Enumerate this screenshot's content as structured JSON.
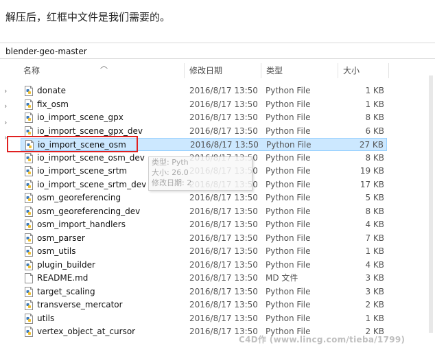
{
  "caption": "解压后，红框中文件是我们需要的。",
  "address": "blender-geo-master",
  "columns": {
    "name": "名称",
    "date": "修改日期",
    "type": "类型",
    "size": "大小"
  },
  "files": [
    {
      "name": "donate",
      "date": "2016/8/17 13:50",
      "type": "Python File",
      "size": "1 KB",
      "icon": "python-file-icon"
    },
    {
      "name": "fix_osm",
      "date": "2016/8/17 13:50",
      "type": "Python File",
      "size": "1 KB",
      "icon": "python-file-icon"
    },
    {
      "name": "io_import_scene_gpx",
      "date": "2016/8/17 13:50",
      "type": "Python File",
      "size": "8 KB",
      "icon": "python-file-icon"
    },
    {
      "name": "io_import_scene_gpx_dev",
      "date": "2016/8/17 13:50",
      "type": "Python File",
      "size": "6 KB",
      "icon": "python-file-icon"
    },
    {
      "name": "io_import_scene_osm",
      "date": "2016/8/17 13:50",
      "type": "Python File",
      "size": "27 KB",
      "icon": "python-file-icon",
      "selected": true
    },
    {
      "name": "io_import_scene_osm_dev",
      "date": "2016/8/17 13:50",
      "type": "Python File",
      "size": "8 KB",
      "icon": "python-file-icon"
    },
    {
      "name": "io_import_scene_srtm",
      "date": "2016/8/17 13:50",
      "type": "Python File",
      "size": "19 KB",
      "icon": "python-file-icon"
    },
    {
      "name": "io_import_scene_srtm_dev",
      "date": "2016/8/17 13:50",
      "type": "Python File",
      "size": "17 KB",
      "icon": "python-file-icon"
    },
    {
      "name": "osm_georeferencing",
      "date": "2016/8/17 13:50",
      "type": "Python File",
      "size": "5 KB",
      "icon": "python-file-icon"
    },
    {
      "name": "osm_georeferencing_dev",
      "date": "2016/8/17 13:50",
      "type": "Python File",
      "size": "8 KB",
      "icon": "python-file-icon"
    },
    {
      "name": "osm_import_handlers",
      "date": "2016/8/17 13:50",
      "type": "Python File",
      "size": "4 KB",
      "icon": "python-file-icon"
    },
    {
      "name": "osm_parser",
      "date": "2016/8/17 13:50",
      "type": "Python File",
      "size": "7 KB",
      "icon": "python-file-icon"
    },
    {
      "name": "osm_utils",
      "date": "2016/8/17 13:50",
      "type": "Python File",
      "size": "1 KB",
      "icon": "python-file-icon"
    },
    {
      "name": "plugin_builder",
      "date": "2016/8/17 13:50",
      "type": "Python File",
      "size": "4 KB",
      "icon": "python-file-icon"
    },
    {
      "name": "README.md",
      "date": "2016/8/17 13:50",
      "type": "MD 文件",
      "size": "3 KB",
      "icon": "document-file-icon"
    },
    {
      "name": "target_scaling",
      "date": "2016/8/17 13:50",
      "type": "Python File",
      "size": "3 KB",
      "icon": "python-file-icon"
    },
    {
      "name": "transverse_mercator",
      "date": "2016/8/17 13:50",
      "type": "Python File",
      "size": "2 KB",
      "icon": "python-file-icon"
    },
    {
      "name": "utils",
      "date": "2016/8/17 13:50",
      "type": "Python File",
      "size": "1 KB",
      "icon": "python-file-icon"
    },
    {
      "name": "vertex_object_at_cursor",
      "date": "2016/8/17 13:50",
      "type": "Python File",
      "size": "2 KB",
      "icon": "python-file-icon"
    }
  ],
  "tooltip": {
    "line1": "类型: Pyth",
    "line2": "大小: 26.0",
    "line3": "修改日期: 2"
  },
  "watermark": "C4D作 (www.lincg.com/tieba/1799)",
  "colors": {
    "selection": "#cce8ff",
    "highlight_box": "#e02020"
  }
}
